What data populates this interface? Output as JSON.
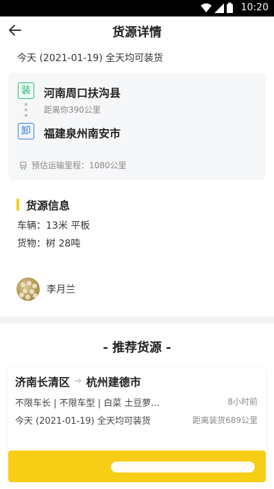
{
  "status_bar": {
    "time": "10:20",
    "icons": [
      "wifi-icon",
      "signal-icon",
      "battery-icon"
    ]
  },
  "header": {
    "title": "货源详情",
    "back_icon": "arrow-left-icon"
  },
  "load_time": "今天 (2021-01-19) 全天均可装货",
  "route": {
    "load_tag": "装",
    "origin": "河南周口扶沟县",
    "distance_from_you": "距离你390公里",
    "unload_tag": "卸",
    "destination": "福建泉州南安市",
    "mileage": "预估运输里程：1080公里"
  },
  "cargo_info": {
    "title": "货源信息",
    "vehicle": "车辆：13米 平板",
    "goods": "货物：树 28吨"
  },
  "shipper": {
    "name": "李月兰"
  },
  "recommend": {
    "title": "- 推荐货源 -",
    "items": [
      {
        "from": "济南长清区",
        "to": "杭州建德市",
        "specs": "不限车长 | 不限车型 | 白菜  土豆萝...",
        "posted": "8小时前",
        "date": "今天 (2021-01-19) 全天均可装货",
        "distance": "距离装货689公里"
      }
    ]
  },
  "cta": {
    "label": ""
  },
  "colors": {
    "accent": "#f7cd16",
    "load_tag": "#2cb47b",
    "unload_tag": "#3a7bd5"
  }
}
